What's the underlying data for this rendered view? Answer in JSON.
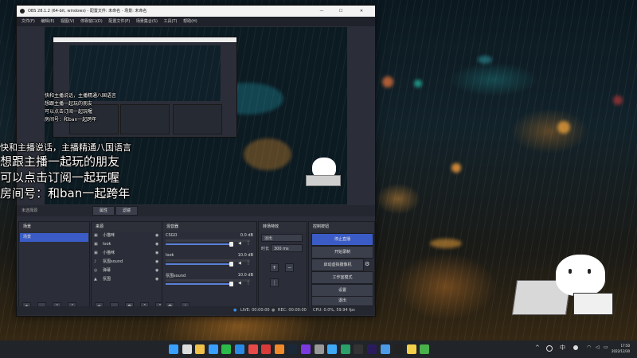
{
  "window": {
    "title": "OBS 28.1.2 (64-bit, windows) - 配置文件: 未命名 - 场景: 未命名",
    "controls": {
      "minimize": "—",
      "maximize": "☐",
      "close": "✕"
    }
  },
  "menu": [
    "文件(F)",
    "编辑(E)",
    "视图(V)",
    "停靠窗口(D)",
    "配置文件(P)",
    "场景集合(S)",
    "工具(T)",
    "帮助(H)"
  ],
  "preview_overlay": {
    "lines": [
      "快和主播说话，主播精通八国语言",
      "想跟主播一起玩的朋友",
      "可以点击订阅一起玩喔",
      "房间号：和ban一起跨年"
    ]
  },
  "transition_bar": {
    "left_label": "未选择源",
    "btn1": "属性",
    "btn2": "滤镜"
  },
  "scenes": {
    "title": "场景",
    "items": [
      "场景"
    ]
  },
  "sources": {
    "title": "来源",
    "items": [
      {
        "label": "小猫咪",
        "icon": "image-icon"
      },
      {
        "label": "look",
        "icon": "image-icon"
      },
      {
        "label": "小猫咪",
        "icon": "image-icon"
      },
      {
        "label": "氛围sound",
        "icon": "audio-icon"
      },
      {
        "label": "弹幕",
        "icon": "browser-icon"
      },
      {
        "label": "氛围",
        "icon": "game-icon"
      }
    ]
  },
  "mixer": {
    "title": "混音器",
    "channels": [
      {
        "name": "CSGO",
        "db": "0.0 dB",
        "level": 0.0
      },
      {
        "name": "look",
        "db": "10.0 dB",
        "level": 0.0
      },
      {
        "name": "氛围sound",
        "db": "10.0 dB",
        "level": 0.0
      }
    ]
  },
  "transitions": {
    "title": "转场特效",
    "selected": "淡出",
    "duration_label": "时长",
    "duration": "300 ms"
  },
  "controls": {
    "title": "控制按钮",
    "buttons": [
      "停止直播",
      "开始录制",
      "启动虚拟摄像机",
      "工作室模式",
      "设置",
      "退出"
    ]
  },
  "statusbar": {
    "live": "LIVE: 00:00:00",
    "rec": "REC: 00:00:00",
    "cpu": "CPU: 0.0%, 59.94 fps"
  },
  "desktop_overlay": {
    "lines": [
      "快和主播说话，主播精通八国语言",
      "想跟主播一起玩的朋友",
      "可以点击订阅一起玩喔",
      "房间号：和ban一起跨年"
    ]
  },
  "taskbar": {
    "tray": {
      "chevron": "^",
      "lang": "中",
      "time": "17:50",
      "date": "2022/12/30"
    },
    "apps": [
      "start",
      "search",
      "files",
      "store",
      "wechat",
      "qq",
      "music",
      "netease",
      "video",
      "steam",
      "game",
      "settings",
      "browser",
      "edge",
      "obs",
      "premiere",
      "photos",
      "terminal",
      "notes",
      "android"
    ],
    "colors": {
      "accent": "#1a73e8",
      "live_button": "#3b5cc6"
    }
  }
}
